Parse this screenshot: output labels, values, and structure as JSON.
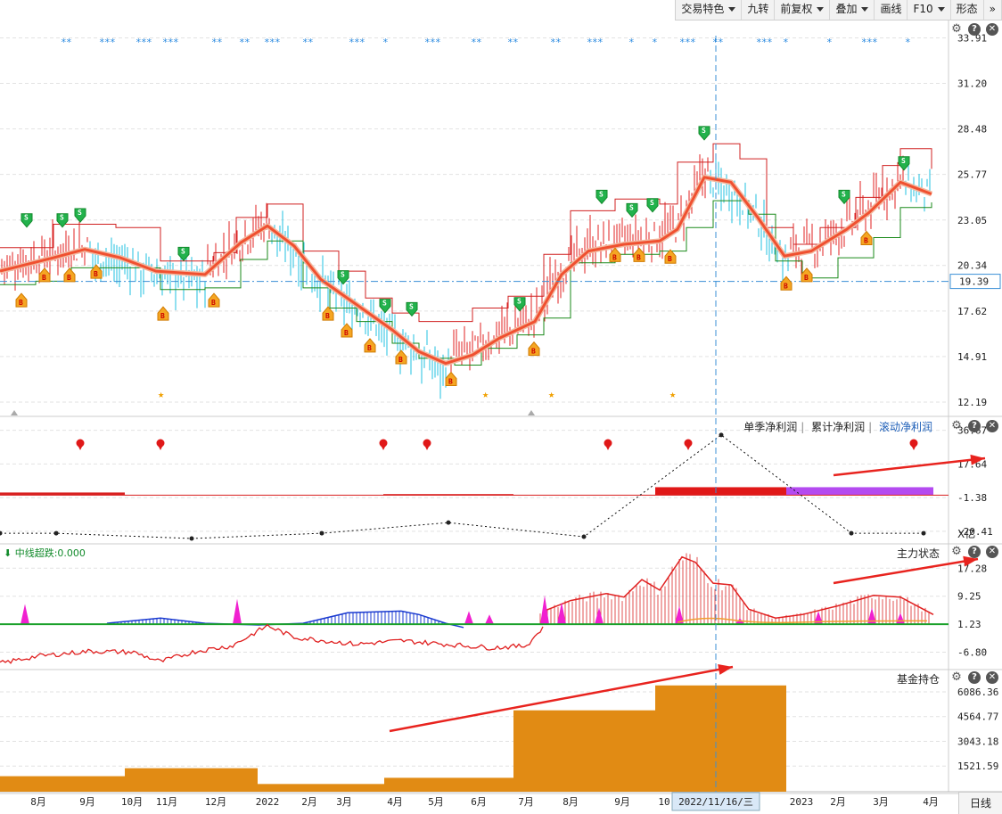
{
  "toolbar": {
    "items": [
      {
        "label": "交易特色",
        "dropdown": true
      },
      {
        "label": "九转",
        "dropdown": false
      },
      {
        "label": "前复权",
        "dropdown": true
      },
      {
        "label": "叠加",
        "dropdown": true
      },
      {
        "label": "画线",
        "dropdown": false
      },
      {
        "label": "F10",
        "dropdown": true
      },
      {
        "label": "形态",
        "dropdown": false
      }
    ],
    "more": "»"
  },
  "colors": {
    "up": "#e02020",
    "down": "#20c0e0",
    "ma": "#f05030",
    "upper": "#d02020",
    "lower": "#1a8a1a",
    "dash": "#3a8fd6",
    "fund": "#e18b14",
    "purple": "#b44af0",
    "arrow": "#e8231e"
  },
  "icons": [
    "gear-icon",
    "help-icon",
    "close-icon"
  ],
  "crosshair_date": "2022/11/16/三",
  "period_label": "日线",
  "chart_data": [
    {
      "type": "candlestick",
      "name": "price",
      "ylim": [
        11.5,
        35.0
      ],
      "y_ticks": [
        "33.91",
        "31.20",
        "28.48",
        "25.77",
        "23.05",
        "20.34",
        "17.62",
        "14.91",
        "12.19"
      ],
      "current_price": "19.39",
      "ma_curve": [
        [
          0,
          20.0
        ],
        [
          60,
          20.8
        ],
        [
          95,
          21.3
        ],
        [
          135,
          20.8
        ],
        [
          175,
          20.0
        ],
        [
          230,
          19.8
        ],
        [
          270,
          21.7
        ],
        [
          300,
          22.7
        ],
        [
          330,
          21.5
        ],
        [
          360,
          19.5
        ],
        [
          400,
          18.0
        ],
        [
          440,
          16.5
        ],
        [
          470,
          15.2
        ],
        [
          500,
          14.5
        ],
        [
          530,
          15.0
        ],
        [
          560,
          16.0
        ],
        [
          600,
          17.0
        ],
        [
          630,
          19.8
        ],
        [
          660,
          21.2
        ],
        [
          700,
          21.6
        ],
        [
          740,
          21.8
        ],
        [
          760,
          22.5
        ],
        [
          790,
          25.6
        ],
        [
          820,
          25.3
        ],
        [
          850,
          23.2
        ],
        [
          880,
          20.9
        ],
        [
          910,
          21.2
        ],
        [
          950,
          22.5
        ],
        [
          975,
          23.5
        ],
        [
          1010,
          25.3
        ],
        [
          1045,
          24.6
        ]
      ],
      "upper_band": [
        [
          0,
          21.4
        ],
        [
          30,
          21.4
        ],
        [
          60,
          22.8
        ],
        [
          130,
          22.6
        ],
        [
          180,
          20.6
        ],
        [
          240,
          21.1
        ],
        [
          265,
          23.2
        ],
        [
          300,
          24.0
        ],
        [
          340,
          21.2
        ],
        [
          380,
          20.0
        ],
        [
          410,
          18.4
        ],
        [
          440,
          17.5
        ],
        [
          470,
          17.0
        ],
        [
          500,
          17.0
        ],
        [
          530,
          17.8
        ],
        [
          570,
          18.5
        ],
        [
          610,
          21.0
        ],
        [
          640,
          23.6
        ],
        [
          690,
          24.3
        ],
        [
          740,
          24.0
        ],
        [
          760,
          26.5
        ],
        [
          800,
          27.6
        ],
        [
          830,
          26.7
        ],
        [
          860,
          22.6
        ],
        [
          890,
          21.6
        ],
        [
          920,
          22.6
        ],
        [
          960,
          24.4
        ],
        [
          990,
          26.3
        ],
        [
          1010,
          27.3
        ],
        [
          1045,
          26.1
        ]
      ],
      "lower_band": [
        [
          0,
          19.2
        ],
        [
          40,
          19.4
        ],
        [
          80,
          20.2
        ],
        [
          130,
          20.2
        ],
        [
          180,
          18.9
        ],
        [
          230,
          19.0
        ],
        [
          270,
          20.7
        ],
        [
          300,
          21.8
        ],
        [
          340,
          19.0
        ],
        [
          370,
          17.8
        ],
        [
          400,
          17.0
        ],
        [
          440,
          15.7
        ],
        [
          470,
          14.8
        ],
        [
          510,
          14.4
        ],
        [
          540,
          15.4
        ],
        [
          580,
          16.2
        ],
        [
          610,
          17.2
        ],
        [
          640,
          20.5
        ],
        [
          690,
          21.0
        ],
        [
          740,
          21.2
        ],
        [
          770,
          22.6
        ],
        [
          800,
          24.2
        ],
        [
          840,
          23.4
        ],
        [
          870,
          20.6
        ],
        [
          900,
          19.6
        ],
        [
          940,
          20.8
        ],
        [
          980,
          22.0
        ],
        [
          1010,
          23.8
        ],
        [
          1045,
          24.1
        ]
      ],
      "buy_signals": [
        [
          24,
          18.3
        ],
        [
          50,
          19.8
        ],
        [
          78,
          19.8
        ],
        [
          108,
          20.0
        ],
        [
          183,
          17.5
        ],
        [
          240,
          18.3
        ],
        [
          368,
          17.5
        ],
        [
          389,
          16.5
        ],
        [
          415,
          15.6
        ],
        [
          450,
          14.9
        ],
        [
          506,
          13.6
        ],
        [
          599,
          15.4
        ],
        [
          690,
          21.0
        ],
        [
          717,
          21.0
        ],
        [
          752,
          20.9
        ],
        [
          882,
          19.3
        ],
        [
          905,
          19.8
        ],
        [
          972,
          22.0
        ]
      ],
      "sell_signals": [
        [
          30,
          23.0
        ],
        [
          70,
          23.0
        ],
        [
          90,
          23.3
        ],
        [
          206,
          21.0
        ],
        [
          385,
          19.6
        ],
        [
          432,
          17.9
        ],
        [
          462,
          17.7
        ],
        [
          583,
          18.0
        ],
        [
          675,
          24.4
        ],
        [
          709,
          23.6
        ],
        [
          732,
          23.9
        ],
        [
          790,
          28.2
        ],
        [
          947,
          24.4
        ],
        [
          1014,
          26.4
        ]
      ],
      "stars": [
        183,
        547,
        621,
        757
      ]
    },
    {
      "type": "bar+line",
      "name": "net-profit",
      "tabs": [
        "单季净利润",
        "累计净利润",
        "滚动净利润"
      ],
      "active_tab": "滚动净利润",
      "unit": "X亿",
      "y_ticks": [
        "36.67",
        "17.64",
        "-1.38",
        "-20.41"
      ],
      "ylim": [
        -26,
        43
      ],
      "bars": [
        {
          "x0": 0,
          "x1": 140,
          "v": 1.5
        },
        {
          "x0": 430,
          "x1": 576,
          "v": 0.6
        },
        {
          "x0": 735,
          "x1": 882,
          "v": 4.5,
          "c": "#e01818"
        },
        {
          "x0": 882,
          "x1": 1047,
          "v": 4.5,
          "c": "#b44af0"
        }
      ],
      "dots": [
        [
          0,
          -21.5
        ],
        [
          63,
          -21.5
        ],
        [
          215,
          -24.5
        ],
        [
          361,
          -21.5
        ],
        [
          503,
          -15.5
        ],
        [
          655,
          -23.5
        ],
        [
          809,
          34.0
        ],
        [
          955,
          -21.5
        ],
        [
          1036,
          -21.5
        ]
      ],
      "markers": [
        90,
        180,
        430,
        479,
        682,
        772,
        1025
      ]
    },
    {
      "type": "line",
      "name": "main-force-state",
      "title": "主力状态",
      "label": "中线超跌:0.000",
      "y_ticks": [
        "17.28",
        "9.25",
        "1.23",
        "-6.80"
      ],
      "ylim": [
        -11,
        24
      ],
      "red_line": [
        [
          0,
          -10.0
        ],
        [
          40,
          -8.0
        ],
        [
          100,
          -6.5
        ],
        [
          150,
          -6.8
        ],
        [
          180,
          -9.5
        ],
        [
          220,
          -6.5
        ],
        [
          260,
          -5.0
        ],
        [
          300,
          0.8
        ],
        [
          330,
          -2.5
        ],
        [
          400,
          -4.5
        ],
        [
          450,
          -3.5
        ],
        [
          500,
          -4.5
        ],
        [
          550,
          -5.5
        ],
        [
          590,
          -5.0
        ],
        [
          610,
          0.5
        ]
      ],
      "red_hist": [
        [
          610,
          5.0
        ],
        [
          640,
          8.0
        ],
        [
          680,
          10.0
        ],
        [
          700,
          9.0
        ],
        [
          720,
          14.0
        ],
        [
          740,
          11.0
        ],
        [
          765,
          20.5
        ],
        [
          780,
          19.0
        ],
        [
          800,
          13.0
        ],
        [
          820,
          12.5
        ],
        [
          840,
          5.5
        ],
        [
          870,
          3.0
        ],
        [
          900,
          4.0
        ],
        [
          940,
          6.5
        ],
        [
          980,
          9.5
        ],
        [
          1010,
          9.0
        ],
        [
          1047,
          4.0
        ]
      ],
      "blue_hist": [
        [
          120,
          1.5
        ],
        [
          180,
          3.0
        ],
        [
          230,
          1.5
        ],
        [
          290,
          1.0
        ],
        [
          340,
          1.5
        ],
        [
          390,
          4.5
        ],
        [
          450,
          5.0
        ],
        [
          470,
          4.0
        ],
        [
          500,
          1.5
        ],
        [
          520,
          0.3
        ]
      ],
      "magenta_spikes": [
        [
          28,
          7.0
        ],
        [
          266,
          8.5
        ],
        [
          526,
          5.0
        ],
        [
          549,
          4.0
        ],
        [
          611,
          9.5
        ],
        [
          630,
          7.5
        ],
        [
          672,
          6.0
        ],
        [
          762,
          6.5
        ],
        [
          830,
          3.0
        ],
        [
          918,
          5.0
        ],
        [
          978,
          6.0
        ],
        [
          1010,
          4.5
        ]
      ]
    },
    {
      "type": "step-area",
      "name": "fund-holdings",
      "title": "基金持仓",
      "y_ticks": [
        "6086.36",
        "4564.77",
        "3043.18",
        "1521.59"
      ],
      "ylim": [
        0,
        7400
      ],
      "steps": [
        {
          "x0": 0,
          "x1": 140,
          "v": 900
        },
        {
          "x0": 140,
          "x1": 289,
          "v": 1390
        },
        {
          "x0": 289,
          "x1": 431,
          "v": 420
        },
        {
          "x0": 431,
          "x1": 576,
          "v": 800
        },
        {
          "x0": 576,
          "x1": 735,
          "v": 4950
        },
        {
          "x0": 735,
          "x1": 882,
          "v": 6480
        }
      ]
    }
  ],
  "x_axis_labels": [
    {
      "label": "8月",
      "x": 43
    },
    {
      "label": "9月",
      "x": 98
    },
    {
      "label": "10月",
      "x": 148
    },
    {
      "label": "11月",
      "x": 187
    },
    {
      "label": "12月",
      "x": 242
    },
    {
      "label": "2022",
      "x": 300
    },
    {
      "label": "2月",
      "x": 347
    },
    {
      "label": "3月",
      "x": 386
    },
    {
      "label": "4月",
      "x": 443
    },
    {
      "label": "5月",
      "x": 489
    },
    {
      "label": "6月",
      "x": 537
    },
    {
      "label": "7月",
      "x": 590
    },
    {
      "label": "8月",
      "x": 640
    },
    {
      "label": "9月",
      "x": 698
    },
    {
      "label": "10",
      "x": 745
    },
    {
      "label": "2023",
      "x": 899
    },
    {
      "label": "2月",
      "x": 940
    },
    {
      "label": "3月",
      "x": 988
    },
    {
      "label": "4月",
      "x": 1044
    }
  ]
}
